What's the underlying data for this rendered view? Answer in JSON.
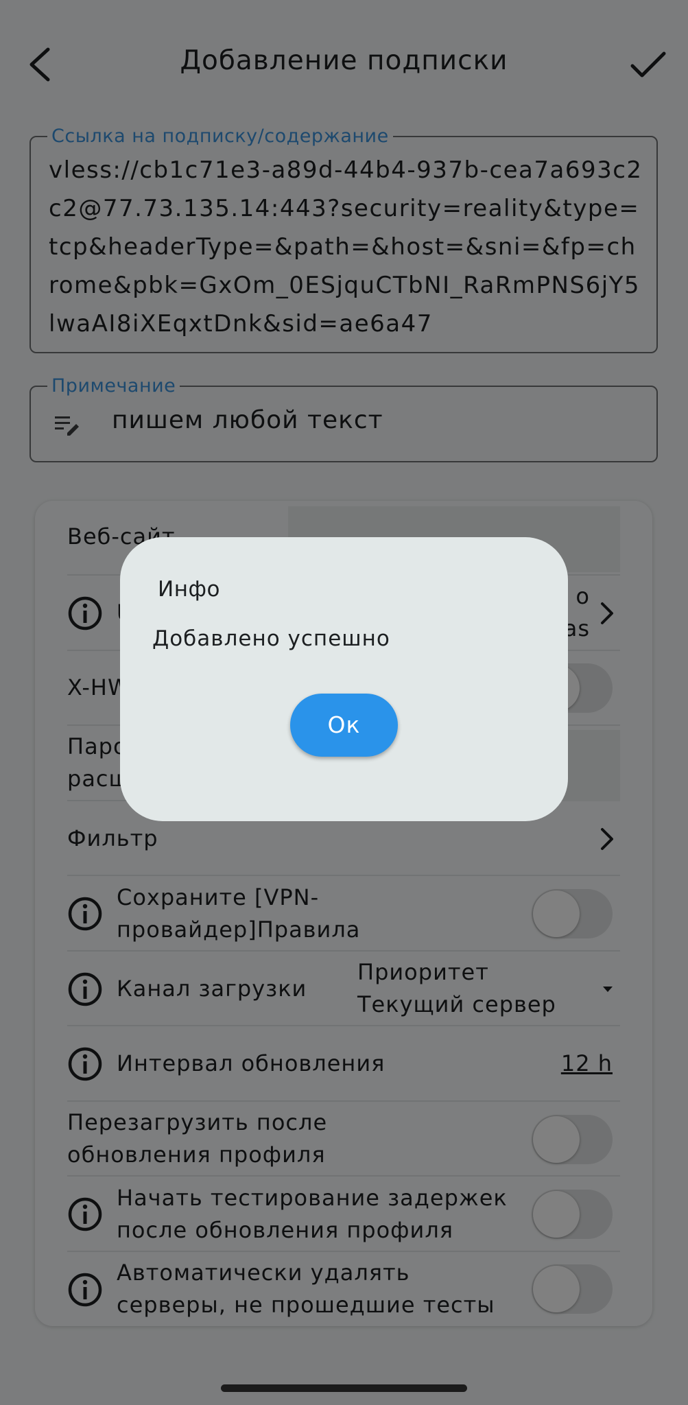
{
  "header": {
    "title": "Добавление подписки"
  },
  "link_field": {
    "label": "Ссылка на подписку/содержание",
    "value": "vless://cb1c71e3-a89d-44b4-937b-cea7a693c2c2@77.73.135.14:443?security=reality&type=tcp&headerType=&path=&host=&sni=&fp=chrome&pbk=GxOm_0ESjquCTbNI_RaRmPNS6jY5lwaAI8iXEqxtDnk&sid=ae6a47"
  },
  "note_field": {
    "label": "Примечание",
    "value": "пишем любой текст",
    "icon": "notes-edit-icon"
  },
  "settings": {
    "website_label": "Веб-сайт",
    "row2_label_fragment": "U",
    "row2_value_fragments": [
      "o",
      "as"
    ],
    "xhwid_label_fragment": "X-HW",
    "password_label_fragments": [
      "Паро",
      "расш"
    ],
    "filter_label": "Фильтр",
    "save_rules_label": "Сохраните [VPN-провайдер]Правила",
    "download_channel_label": "Канал загрузки",
    "download_channel_value": "Приоритет Текущий сервер",
    "update_interval_label": "Интервал обновления",
    "update_interval_value": "12 h",
    "reload_after_update_label": "Перезагрузить после обновления профиля",
    "latency_test_label": "Начать тестирование задержек после обновления профиля",
    "auto_delete_label": "Автоматически удалять серверы, не прошедшие тесты на задержку"
  },
  "toggles": {
    "xhwid": false,
    "save_rules": false,
    "reload_after_update": false,
    "latency_test": false,
    "auto_delete": false
  },
  "dialog": {
    "title": "Инфо",
    "message": "Добавлено успешно",
    "ok_label": "Ок"
  },
  "colors": {
    "accent": "#2a93ea",
    "label_blue": "#3a8fd8",
    "background": "#f1f4f5",
    "dialog_bg": "#e2e8e8"
  }
}
